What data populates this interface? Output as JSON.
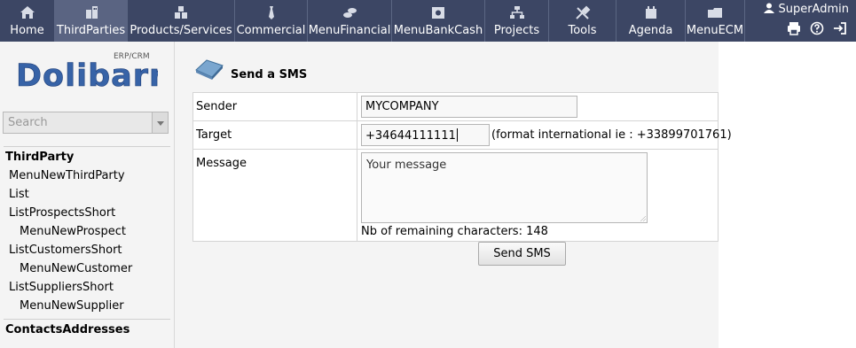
{
  "topmenu": {
    "items": [
      {
        "label": "Home",
        "icon": "home-icon"
      },
      {
        "label": "ThirdParties",
        "icon": "building-icon",
        "active": true
      },
      {
        "label": "Products/Services",
        "icon": "boxes-icon"
      },
      {
        "label": "Commercial",
        "icon": "tie-icon"
      },
      {
        "label": "MenuFinancial",
        "icon": "coins-icon"
      },
      {
        "label": "MenuBankCash",
        "icon": "safe-icon"
      },
      {
        "label": "Projects",
        "icon": "hierarchy-icon"
      },
      {
        "label": "Tools",
        "icon": "tools-icon"
      },
      {
        "label": "Agenda",
        "icon": "agenda-icon"
      },
      {
        "label": "MenuECM",
        "icon": "folders-icon"
      }
    ],
    "user": "SuperAdmin"
  },
  "brand": {
    "name": "Dolibarr",
    "tag": "ERP/CRM"
  },
  "search": {
    "placeholder": "Search"
  },
  "sidebar": {
    "groups": [
      {
        "title": "ThirdParty",
        "items": [
          {
            "label": "MenuNewThirdParty",
            "sub": false
          },
          {
            "label": "List",
            "sub": false
          },
          {
            "label": "ListProspectsShort",
            "sub": false
          },
          {
            "label": "MenuNewProspect",
            "sub": true
          },
          {
            "label": "ListCustomersShort",
            "sub": false
          },
          {
            "label": "MenuNewCustomer",
            "sub": true
          },
          {
            "label": "ListSuppliersShort",
            "sub": false
          },
          {
            "label": "MenuNewSupplier",
            "sub": true
          }
        ]
      },
      {
        "title": "ContactsAddresses",
        "items": []
      }
    ]
  },
  "page": {
    "title": "Send a SMS",
    "sender_label": "Sender",
    "sender_value": "MYCOMPANY",
    "target_label": "Target",
    "target_value": "+34644111111",
    "target_hint": "(format international ie : +33899701761)",
    "message_label": "Message",
    "message_placeholder": "Your message",
    "remaining": "Nb of remaining characters: 148",
    "send_label": "Send SMS"
  },
  "colors": {
    "topbar": "#3c4664",
    "active_tab": "#5a6482",
    "logo_blue": "#3763a7"
  }
}
